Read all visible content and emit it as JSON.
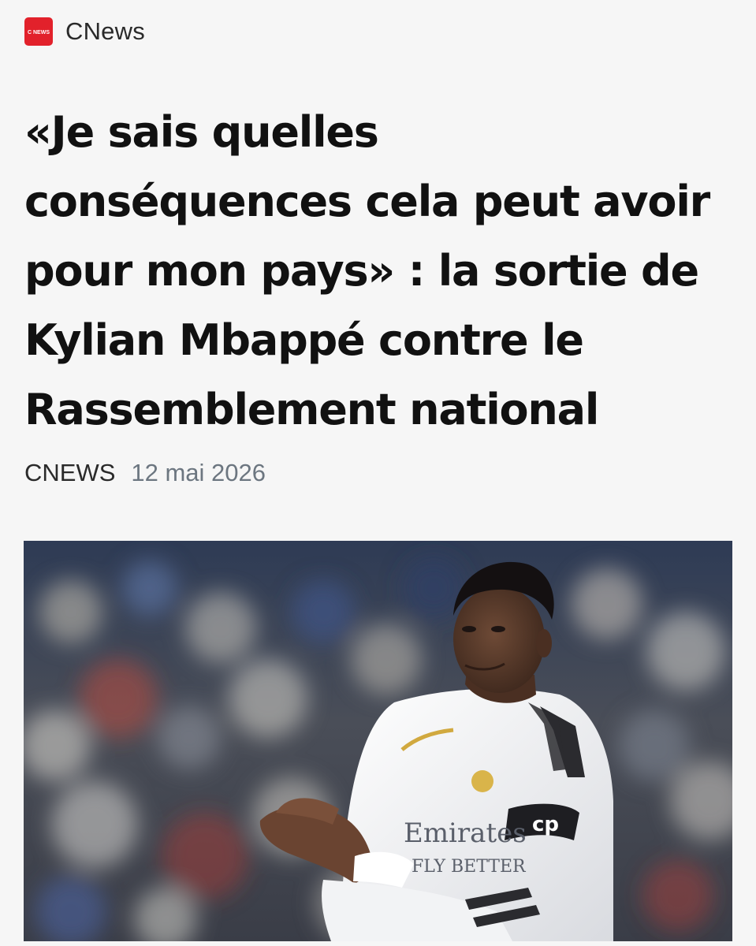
{
  "source": {
    "name": "CNews",
    "logo_text": "C NEWS",
    "brand_color": "#e2212b",
    "logo_icon": "cnews-logo-icon"
  },
  "article": {
    "headline_lines": [
      "«Je sais quelles",
      "conséquences cela peut avoir",
      "pour mon pays» : la sortie de",
      "Kylian Mbappé contre le",
      "Rassemblement national"
    ],
    "author": "CNEWS",
    "date": "12 mai 2026"
  },
  "hero_image": {
    "jersey_sponsor_line1": "Emirates",
    "jersey_sponsor_line2": "FLY BETTER",
    "armband_text": "cp"
  }
}
